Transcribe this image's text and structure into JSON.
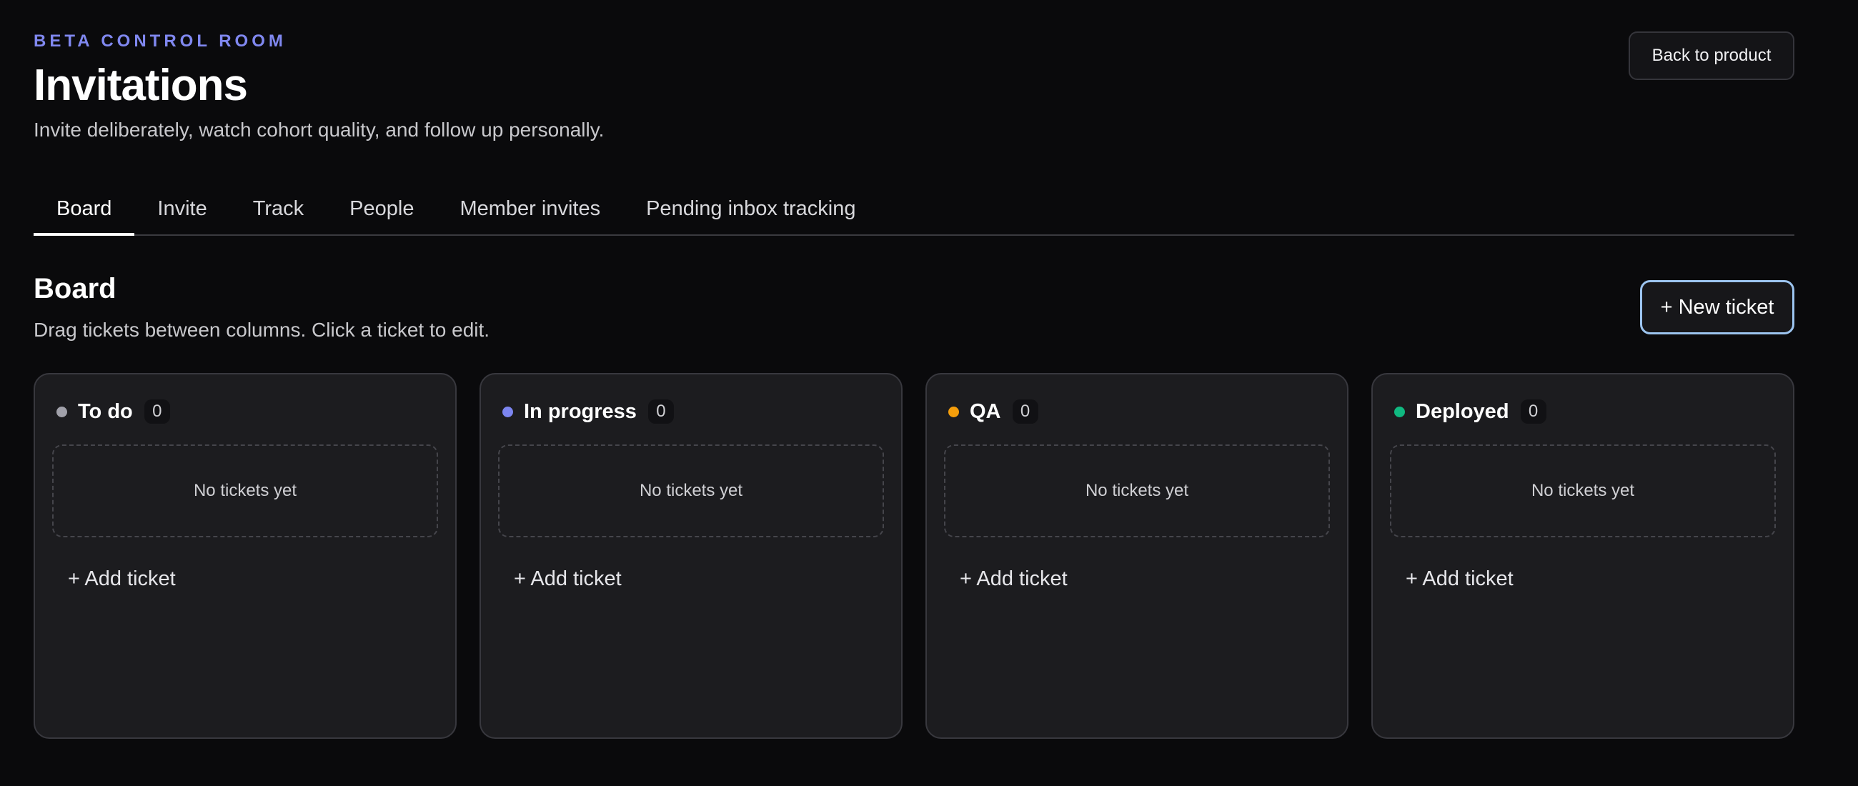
{
  "header": {
    "eyebrow": "BETA CONTROL ROOM",
    "title": "Invitations",
    "subtitle": "Invite deliberately, watch cohort quality, and follow up personally.",
    "back_button_label": "Back to product"
  },
  "tabs": [
    {
      "label": "Board",
      "active": true
    },
    {
      "label": "Invite",
      "active": false
    },
    {
      "label": "Track",
      "active": false
    },
    {
      "label": "People",
      "active": false
    },
    {
      "label": "Member invites",
      "active": false
    },
    {
      "label": "Pending inbox tracking",
      "active": false
    }
  ],
  "board": {
    "title": "Board",
    "subtitle": "Drag tickets between columns. Click a ticket to edit.",
    "new_ticket_label": "+ New ticket",
    "columns": [
      {
        "name": "To do",
        "count": "0",
        "color": "#a1a1aa",
        "empty_text": "No tickets yet",
        "add_label": "+ Add ticket"
      },
      {
        "name": "In progress",
        "count": "0",
        "color": "#7c85f0",
        "empty_text": "No tickets yet",
        "add_label": "+ Add ticket"
      },
      {
        "name": "QA",
        "count": "0",
        "color": "#f59e0b",
        "empty_text": "No tickets yet",
        "add_label": "+ Add ticket"
      },
      {
        "name": "Deployed",
        "count": "0",
        "color": "#10b981",
        "empty_text": "No tickets yet",
        "add_label": "+ Add ticket"
      }
    ]
  },
  "colors": {
    "accent": "#8088f0",
    "focus_ring": "#9cc4ef",
    "background": "#0a0a0c"
  }
}
